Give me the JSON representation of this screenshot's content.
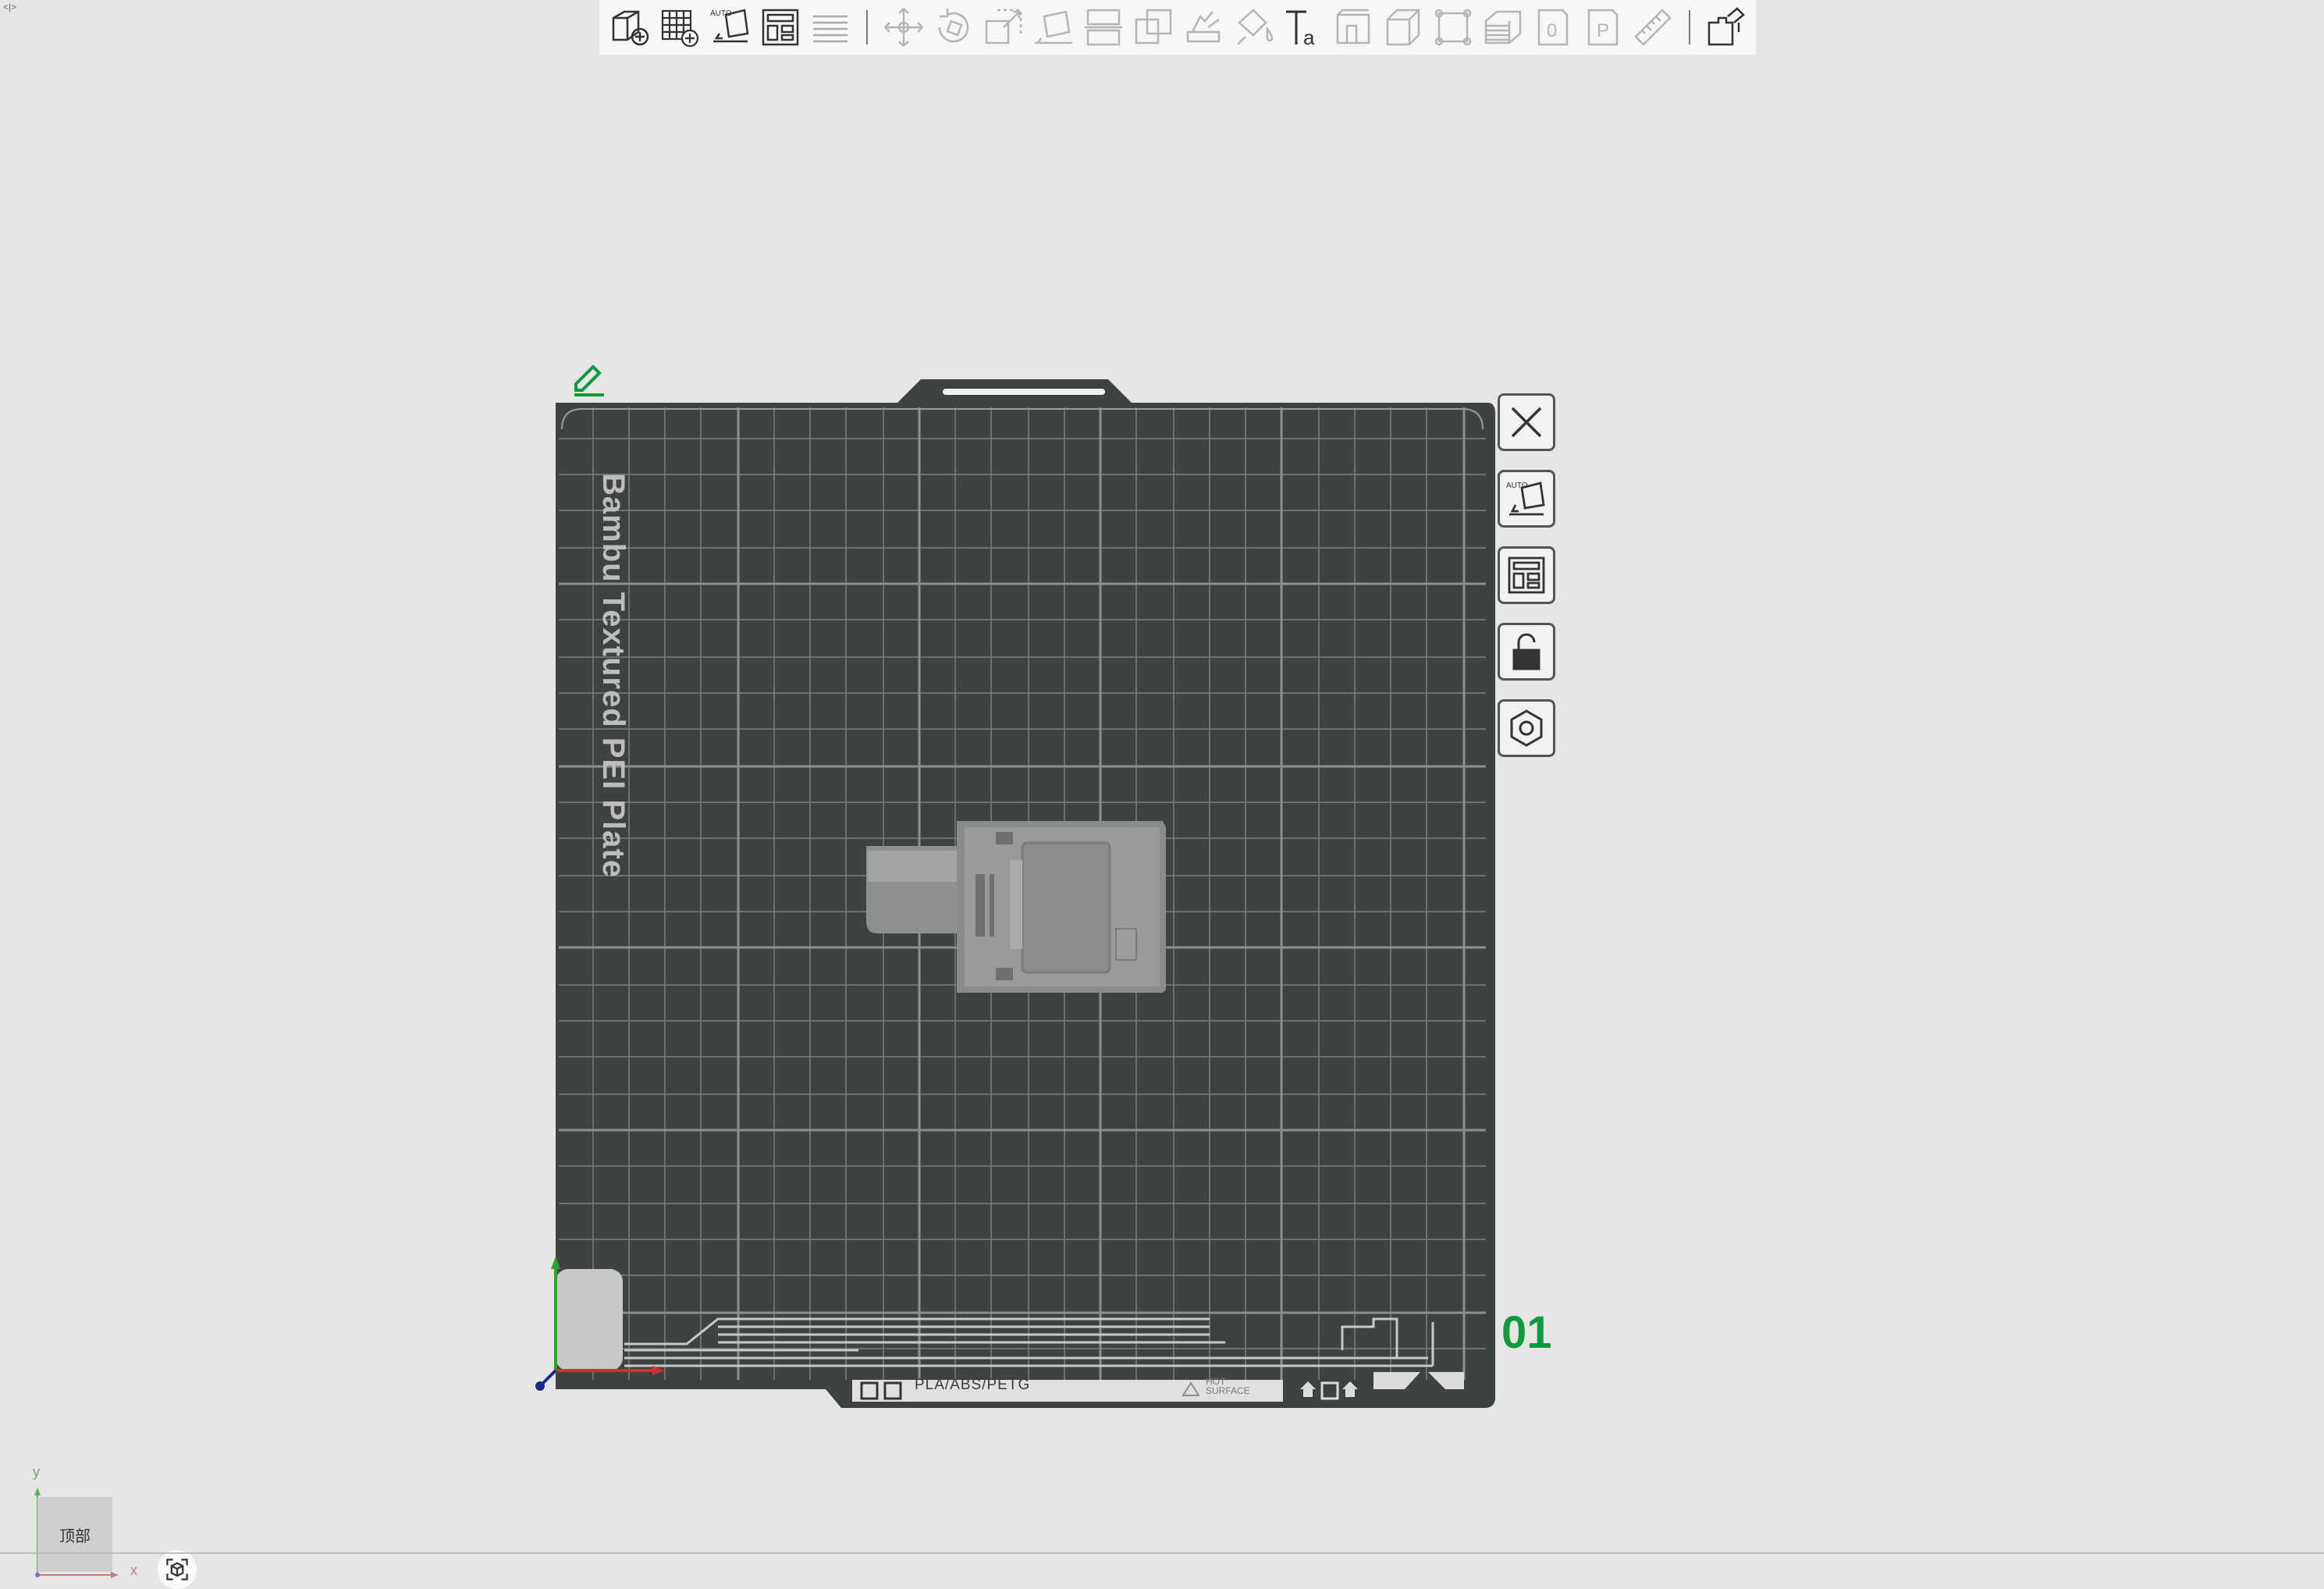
{
  "window": {
    "corner_mark": "<|>"
  },
  "toolbar": {
    "group1": [
      {
        "name": "add-object-icon",
        "enabled": true
      },
      {
        "name": "add-plate-icon",
        "enabled": true
      },
      {
        "name": "auto-orient-icon",
        "enabled": true
      },
      {
        "name": "arrange-icon",
        "enabled": true
      },
      {
        "name": "split-layers-icon",
        "enabled": false
      }
    ],
    "group2": [
      {
        "name": "move-icon",
        "enabled": false
      },
      {
        "name": "rotate-icon",
        "enabled": false
      },
      {
        "name": "scale-icon",
        "enabled": false
      },
      {
        "name": "lay-on-face-icon",
        "enabled": false
      },
      {
        "name": "cut-icon",
        "enabled": false
      },
      {
        "name": "boolean-icon",
        "enabled": false
      },
      {
        "name": "support-paint-icon",
        "enabled": false
      },
      {
        "name": "color-paint-icon",
        "enabled": false
      },
      {
        "name": "text-icon",
        "enabled": true
      },
      {
        "name": "emboss-icon",
        "enabled": false
      },
      {
        "name": "box-icon",
        "enabled": false
      },
      {
        "name": "measure-frame-icon",
        "enabled": false
      },
      {
        "name": "layers-icon",
        "enabled": false
      },
      {
        "name": "plate-0-icon",
        "enabled": false
      },
      {
        "name": "plate-p-icon",
        "enabled": false
      },
      {
        "name": "ruler-icon",
        "enabled": false
      }
    ],
    "group3": [
      {
        "name": "assembly-icon",
        "enabled": true
      }
    ]
  },
  "plate": {
    "label": "Bambu Textured PEI Plate",
    "number": "01",
    "strip_text": "PLA/ABS/PETG",
    "hot_line1": "HOT",
    "hot_line2": "SURFACE",
    "side_buttons": [
      {
        "name": "delete-plate-button",
        "icon": "close-icon"
      },
      {
        "name": "auto-orient-plate-button",
        "icon": "auto-orient-icon"
      },
      {
        "name": "arrange-plate-button",
        "icon": "arrange-icon"
      },
      {
        "name": "lock-plate-button",
        "icon": "unlock-icon"
      },
      {
        "name": "plate-settings-button",
        "icon": "hexagon-settings-icon"
      }
    ]
  },
  "view": {
    "cube_label": "顶部",
    "y_axis": "y",
    "x_axis": "x"
  },
  "colors": {
    "background": "#e6e6e6",
    "plate": "#3f4242",
    "grid": "#7c7f7f",
    "accent_green": "#0f9a3b",
    "axis_x": "#d23030",
    "axis_y": "#2aa52a",
    "axis_z": "#1a2a8a"
  }
}
